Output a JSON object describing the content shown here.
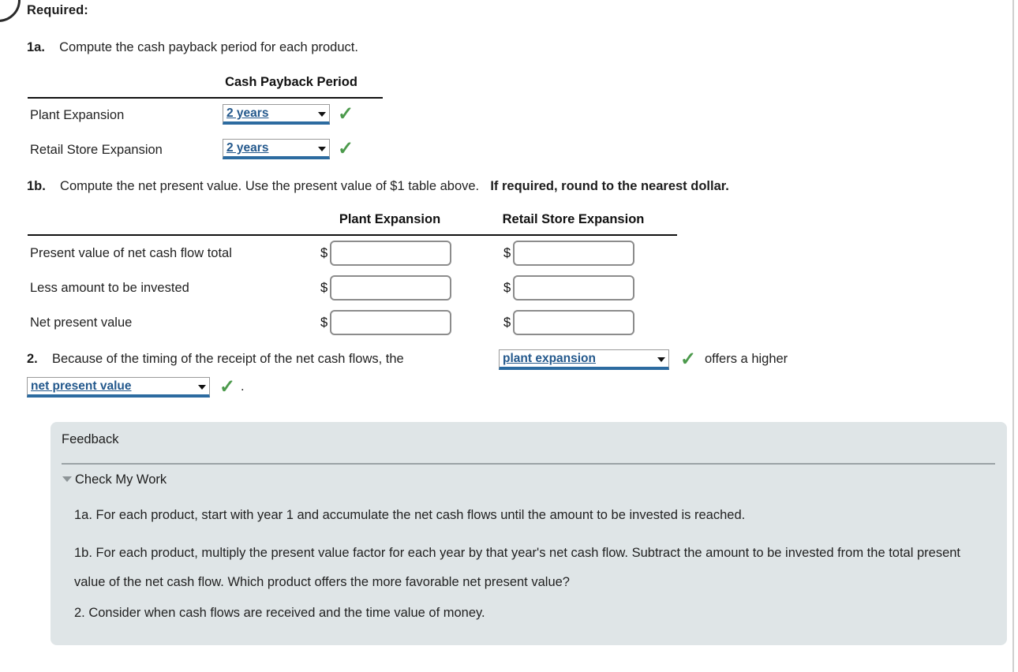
{
  "page": {
    "required_label": "Required:"
  },
  "q1a": {
    "number": "1a.",
    "text": "Compute the cash payback period for each product.",
    "table": {
      "column_header": "Cash Payback Period",
      "rows": [
        {
          "label": "Plant Expansion",
          "answer": "2 years",
          "status_icon": "check-icon"
        },
        {
          "label": "Retail Store Expansion",
          "answer": "2 years",
          "status_icon": "check-icon"
        }
      ]
    }
  },
  "q1b": {
    "number": "1b.",
    "text": "Compute the net present value. Use the present value of $1 table above.",
    "text_bold": "If required, round to the nearest dollar.",
    "table": {
      "column_headers": [
        "Plant Expansion",
        "Retail Store Expansion"
      ],
      "currency_symbol": "$",
      "rows": [
        {
          "label": "Present value of net cash flow total",
          "plant_value": "",
          "retail_value": ""
        },
        {
          "label": "Less amount to be invested",
          "plant_value": "",
          "retail_value": ""
        },
        {
          "label": "Net present value",
          "plant_value": "",
          "retail_value": ""
        }
      ]
    }
  },
  "q2": {
    "number": "2.",
    "text_before": "Because of the timing of the receipt of the net cash flows, the",
    "dropdown_1": "plant expansion",
    "text_middle": "offers a higher",
    "dropdown_2": "net present value",
    "text_after": "."
  },
  "feedback": {
    "title": "Feedback",
    "check_my_work": "Check My Work",
    "paragraphs": [
      "1a. For each product, start with year 1 and accumulate the net cash flows until the amount to be invested is reached.",
      "1b. For each product, multiply the present value factor for each year by that year's net cash flow. Subtract the amount to be invested from the total present value of the net cash flow. Which product offers the more favorable net present value?",
      "2. Consider when cash flows are received and the time value of money."
    ]
  },
  "colors": {
    "feedback_bg": "#dfe5e7",
    "dropdown_text": "#23588c",
    "dropdown_underline": "#2c6ba0",
    "check_green": "#4c9a4c"
  }
}
